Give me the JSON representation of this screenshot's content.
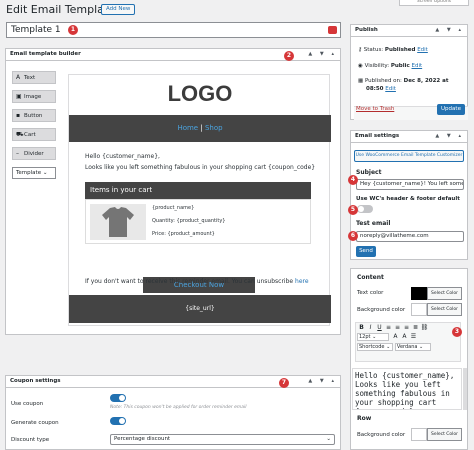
{
  "header": {
    "title": "Edit Email Templates",
    "add_new": "Add New",
    "screen_options": "Screen Options"
  },
  "template_title": "Template 1",
  "markers": [
    "1",
    "2",
    "3",
    "4",
    "5",
    "6",
    "7"
  ],
  "builder": {
    "title": "Email template builder",
    "tools": [
      {
        "icon": "A",
        "label": "Text"
      },
      {
        "icon": "▣",
        "label": "Image"
      },
      {
        "icon": "▪",
        "label": "Button"
      },
      {
        "icon": "⛟",
        "label": "Cart"
      },
      {
        "icon": "–",
        "label": "Divider"
      }
    ],
    "template_select": "Template"
  },
  "email": {
    "logo": "LOGO",
    "nav_home": "Home",
    "nav_sep": "|",
    "nav_shop": "Shop",
    "greeting": "Hello {customer_name},",
    "body_line": "Looks like you left something fabulous in your shopping cart {coupon_code}",
    "cart_title": "Items in your cart",
    "product_name": "{product_name}",
    "quantity": "Quantity: {product_quantity}",
    "price": "Price: {product_amount}",
    "checkout": "Checkout Now",
    "unsubscribe_text": "If you don't want to receive this reminder email. You can unsubscribe",
    "unsubscribe_link": "here",
    "footer": "{site_url}"
  },
  "publish": {
    "title": "Publish",
    "status_label": "Status:",
    "status_value": "Published",
    "status_edit": "Edit",
    "visibility_label": "Visibility:",
    "visibility_value": "Public",
    "visibility_edit": "Edit",
    "published_label": "Published on:",
    "published_value": "Dec 8, 2022 at",
    "published_time": "08:50",
    "published_edit": "Edit",
    "trash": "Move to Trash",
    "update": "Update"
  },
  "email_settings": {
    "title": "Email settings",
    "wc_button": "Use WooCommerce Email Template Customizer",
    "subject_label": "Subject",
    "subject_value": "Hey {customer_name}! You left somet",
    "wc_header_label": "Use WC's header & footer default",
    "test_email_label": "Test email",
    "test_email_value": "noreply@villatheme.com",
    "send": "Send"
  },
  "content_panel": {
    "title": "Content",
    "text_color_label": "Text color",
    "text_color": "#000000",
    "bg_color_label": "Background color",
    "select_color": "Select Color",
    "font_size": "12pt",
    "shortcode": "Shortcode",
    "font_family": "Verdana",
    "preview_text": "Hello {customer_name}, Looks like you left something fabulous in your shopping cart {coupon_code}",
    "row_title": "Row",
    "row_bg_label": "Background color"
  },
  "coupon": {
    "title": "Coupon settings",
    "use_coupon": "Use coupon",
    "note": "Note: This coupon won't be applied for order reminder email",
    "generate_coupon": "Generate coupon",
    "discount_type_label": "Discount type",
    "discount_type_value": "Percentage discount"
  },
  "colors": {
    "accent": "#2271b1",
    "marker": "#d63638",
    "dark_band": "#444444",
    "link": "#4aa3df"
  }
}
